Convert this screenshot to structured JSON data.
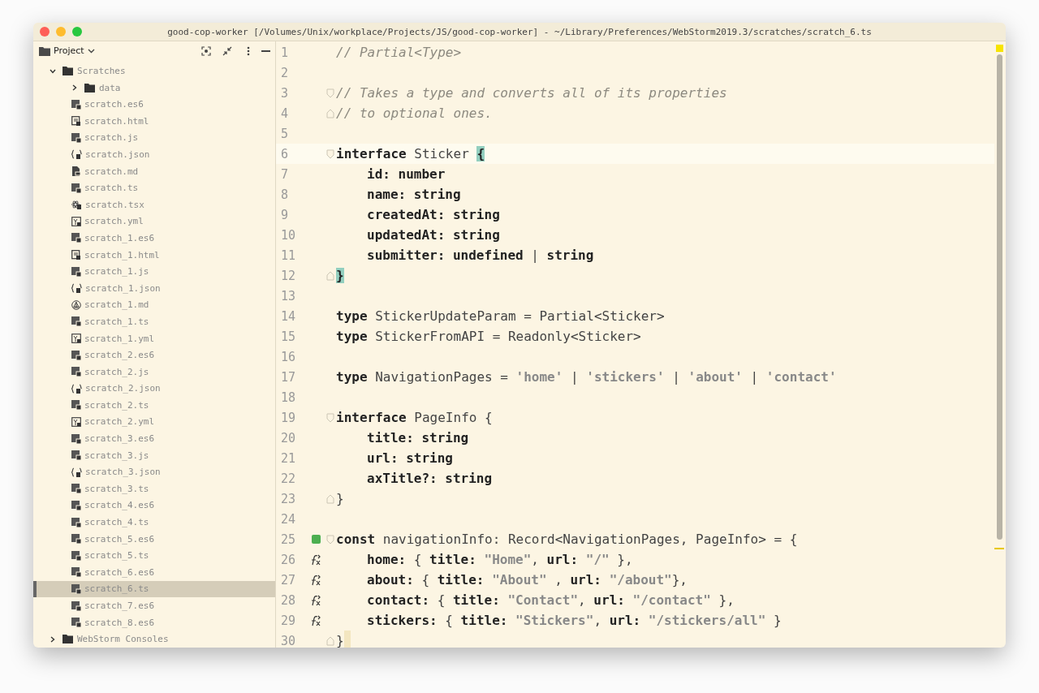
{
  "window": {
    "title": "good-cop-worker [/Volumes/Unix/workplace/Projects/JS/good-cop-worker] - ~/Library/Preferences/WebStorm2019.3/scratches/scratch_6.ts"
  },
  "project_panel": {
    "title": "Project",
    "tree": [
      {
        "label": "Scratches",
        "kind": "folder",
        "expanded": true,
        "selected": false,
        "children": [
          {
            "label": "data",
            "kind": "folder",
            "expanded": false,
            "selected": false
          },
          {
            "label": "scratch.es6",
            "kind": "es6",
            "selected": false
          },
          {
            "label": "scratch.html",
            "kind": "html",
            "selected": false
          },
          {
            "label": "scratch.js",
            "kind": "js",
            "selected": false
          },
          {
            "label": "scratch.json",
            "kind": "json",
            "selected": false
          },
          {
            "label": "scratch.md",
            "kind": "md",
            "selected": false
          },
          {
            "label": "scratch.ts",
            "kind": "ts",
            "selected": false
          },
          {
            "label": "scratch.tsx",
            "kind": "tsx",
            "selected": false
          },
          {
            "label": "scratch.yml",
            "kind": "yml",
            "selected": false
          },
          {
            "label": "scratch_1.es6",
            "kind": "es6",
            "selected": false
          },
          {
            "label": "scratch_1.html",
            "kind": "html",
            "selected": false
          },
          {
            "label": "scratch_1.js",
            "kind": "js",
            "selected": false
          },
          {
            "label": "scratch_1.json",
            "kind": "json",
            "selected": false
          },
          {
            "label": "scratch_1.md",
            "kind": "preview",
            "selected": false
          },
          {
            "label": "scratch_1.ts",
            "kind": "ts",
            "selected": false
          },
          {
            "label": "scratch_1.yml",
            "kind": "yml",
            "selected": false
          },
          {
            "label": "scratch_2.es6",
            "kind": "es6",
            "selected": false
          },
          {
            "label": "scratch_2.js",
            "kind": "js",
            "selected": false
          },
          {
            "label": "scratch_2.json",
            "kind": "json",
            "selected": false
          },
          {
            "label": "scratch_2.ts",
            "kind": "ts",
            "selected": false
          },
          {
            "label": "scratch_2.yml",
            "kind": "yml",
            "selected": false
          },
          {
            "label": "scratch_3.es6",
            "kind": "es6",
            "selected": false
          },
          {
            "label": "scratch_3.js",
            "kind": "js",
            "selected": false
          },
          {
            "label": "scratch_3.json",
            "kind": "json",
            "selected": false
          },
          {
            "label": "scratch_3.ts",
            "kind": "ts",
            "selected": false
          },
          {
            "label": "scratch_4.es6",
            "kind": "es6",
            "selected": false
          },
          {
            "label": "scratch_4.ts",
            "kind": "ts",
            "selected": false
          },
          {
            "label": "scratch_5.es6",
            "kind": "es6",
            "selected": false
          },
          {
            "label": "scratch_5.ts",
            "kind": "ts",
            "selected": false
          },
          {
            "label": "scratch_6.es6",
            "kind": "es6",
            "selected": false
          },
          {
            "label": "scratch_6.ts",
            "kind": "ts",
            "selected": true
          },
          {
            "label": "scratch_7.es6",
            "kind": "es6",
            "selected": false
          },
          {
            "label": "scratch_8.es6",
            "kind": "es6",
            "selected": false
          }
        ]
      },
      {
        "label": "WebStorm Consoles",
        "kind": "folder",
        "expanded": false,
        "selected": false
      }
    ]
  },
  "editor": {
    "lines": [
      {
        "n": "1",
        "tokens": [
          {
            "t": "// Partial<Type>",
            "kind": "comment"
          }
        ]
      },
      {
        "n": "2"
      },
      {
        "n": "3",
        "fold": {
          "kind": "open"
        },
        "tokens": [
          {
            "t": "// Takes a type and converts all of its properties",
            "kind": "comment"
          }
        ]
      },
      {
        "n": "4",
        "fold": {
          "kind": "close"
        },
        "tokens": [
          {
            "t": "// to optional ones.",
            "kind": "comment"
          }
        ]
      },
      {
        "n": "5"
      },
      {
        "n": "6",
        "fold": {
          "kind": "open"
        },
        "current": true,
        "tokens": [
          {
            "t": "interface",
            "kind": "kw"
          },
          {
            "t": " Sticker ",
            "kind": "plain"
          },
          {
            "t": "{",
            "kind": "brace"
          }
        ]
      },
      {
        "n": "7",
        "indent": true,
        "tokens": [
          {
            "t": "id: number",
            "kind": "kw"
          }
        ]
      },
      {
        "n": "8",
        "indent": true,
        "tokens": [
          {
            "t": "name: string",
            "kind": "kw"
          }
        ]
      },
      {
        "n": "9",
        "indent": true,
        "tokens": [
          {
            "t": "createdAt: string",
            "kind": "kw"
          }
        ]
      },
      {
        "n": "10",
        "indent": true,
        "tokens": [
          {
            "t": "updatedAt: string",
            "kind": "kw"
          }
        ]
      },
      {
        "n": "11",
        "indent": true,
        "tokens": [
          {
            "t": "submitter: undefined",
            "kind": "kw"
          },
          {
            "t": " | ",
            "kind": "plain"
          },
          {
            "t": "string",
            "kind": "kw"
          }
        ]
      },
      {
        "n": "12",
        "fold": {
          "kind": "close"
        },
        "tokens": [
          {
            "t": "}",
            "kind": "brace"
          }
        ]
      },
      {
        "n": "13"
      },
      {
        "n": "14",
        "tokens": [
          {
            "t": "type",
            "kind": "kw"
          },
          {
            "t": " StickerUpdateParam = Partial<Sticker>",
            "kind": "plain"
          }
        ]
      },
      {
        "n": "15",
        "tokens": [
          {
            "t": "type",
            "kind": "kw"
          },
          {
            "t": " StickerFromAPI = Readonly<Sticker>",
            "kind": "plain"
          }
        ]
      },
      {
        "n": "16"
      },
      {
        "n": "17",
        "tokens": [
          {
            "t": "type",
            "kind": "kw"
          },
          {
            "t": " NavigationPages = ",
            "kind": "plain"
          },
          {
            "t": "'home'",
            "kind": "str"
          },
          {
            "t": " | ",
            "kind": "plain"
          },
          {
            "t": "'stickers'",
            "kind": "str"
          },
          {
            "t": " | ",
            "kind": "plain"
          },
          {
            "t": "'about'",
            "kind": "str"
          },
          {
            "t": " | ",
            "kind": "plain"
          },
          {
            "t": "'contact'",
            "kind": "str"
          }
        ]
      },
      {
        "n": "18"
      },
      {
        "n": "19",
        "fold": {
          "kind": "open"
        },
        "tokens": [
          {
            "t": "interface",
            "kind": "kw"
          },
          {
            "t": " PageInfo {",
            "kind": "plain"
          }
        ]
      },
      {
        "n": "20",
        "indent": true,
        "tokens": [
          {
            "t": "title: string",
            "kind": "kw"
          }
        ]
      },
      {
        "n": "21",
        "indent": true,
        "tokens": [
          {
            "t": "url: string",
            "kind": "kw"
          }
        ]
      },
      {
        "n": "22",
        "indent": true,
        "tokens": [
          {
            "t": "axTitle?: string",
            "kind": "kw"
          }
        ]
      },
      {
        "n": "23",
        "fold": {
          "kind": "close"
        },
        "tokens": [
          {
            "t": "}",
            "kind": "plain"
          }
        ]
      },
      {
        "n": "24"
      },
      {
        "n": "25",
        "fold": {
          "kind": "open"
        },
        "gutter": {
          "kind": "implemented"
        },
        "tokens": [
          {
            "t": "const",
            "kind": "kw"
          },
          {
            "t": " navigationInfo: Record<NavigationPages, PageInfo> = {",
            "kind": "plain"
          }
        ]
      },
      {
        "n": "26",
        "indent": true,
        "gutter": {
          "kind": "recursive"
        },
        "tokens": [
          {
            "t": "home:",
            "kind": "kw"
          },
          {
            "t": " { ",
            "kind": "plain"
          },
          {
            "t": "title:",
            "kind": "kw"
          },
          {
            "t": " \"Home\"",
            "kind": "str"
          },
          {
            "t": ", ",
            "kind": "plain"
          },
          {
            "t": "url:",
            "kind": "kw"
          },
          {
            "t": " \"/\"",
            "kind": "str"
          },
          {
            "t": " },",
            "kind": "plain"
          }
        ]
      },
      {
        "n": "27",
        "indent": true,
        "gutter": {
          "kind": "recursive"
        },
        "tokens": [
          {
            "t": "about:",
            "kind": "kw"
          },
          {
            "t": " { ",
            "kind": "plain"
          },
          {
            "t": "title:",
            "kind": "kw"
          },
          {
            "t": " \"About\"",
            "kind": "str"
          },
          {
            "t": " , ",
            "kind": "plain"
          },
          {
            "t": "url:",
            "kind": "kw"
          },
          {
            "t": " \"/about\"",
            "kind": "str"
          },
          {
            "t": "},",
            "kind": "plain"
          }
        ]
      },
      {
        "n": "28",
        "indent": true,
        "gutter": {
          "kind": "recursive"
        },
        "tokens": [
          {
            "t": "contact:",
            "kind": "kw"
          },
          {
            "t": " { ",
            "kind": "plain"
          },
          {
            "t": "title:",
            "kind": "kw"
          },
          {
            "t": " \"Contact\"",
            "kind": "str"
          },
          {
            "t": ", ",
            "kind": "plain"
          },
          {
            "t": "url:",
            "kind": "kw"
          },
          {
            "t": " \"/contact\"",
            "kind": "str"
          },
          {
            "t": " },",
            "kind": "plain"
          }
        ]
      },
      {
        "n": "29",
        "indent": true,
        "gutter": {
          "kind": "recursive"
        },
        "tokens": [
          {
            "t": "stickers:",
            "kind": "kw"
          },
          {
            "t": " { ",
            "kind": "plain"
          },
          {
            "t": "title:",
            "kind": "kw"
          },
          {
            "t": " \"Stickers\"",
            "kind": "str"
          },
          {
            "t": ", ",
            "kind": "plain"
          },
          {
            "t": "url:",
            "kind": "kw"
          },
          {
            "t": " \"/stickers/all\"",
            "kind": "str"
          },
          {
            "t": " }",
            "kind": "plain"
          }
        ]
      },
      {
        "n": "30",
        "fold": {
          "kind": "close"
        },
        "cursor": true,
        "tokens": [
          {
            "t": "}",
            "kind": "plain"
          }
        ]
      }
    ]
  }
}
